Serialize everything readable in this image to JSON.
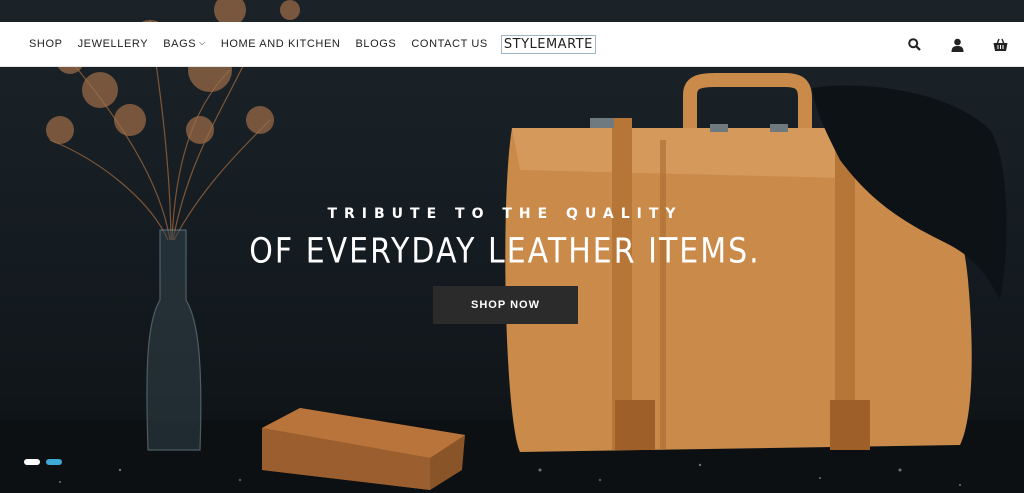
{
  "nav": {
    "items": [
      {
        "label": "SHOP",
        "has_dropdown": false
      },
      {
        "label": "JEWELLERY",
        "has_dropdown": false
      },
      {
        "label": "BAGS",
        "has_dropdown": true
      },
      {
        "label": "HOME AND KITCHEN",
        "has_dropdown": false
      },
      {
        "label": "BLOGS",
        "has_dropdown": false
      },
      {
        "label": "CONTACT US",
        "has_dropdown": false
      }
    ],
    "logo_text": "STYLEMARTE",
    "icons": [
      "search-icon",
      "user-icon",
      "cart-icon"
    ]
  },
  "hero": {
    "subtitle": "TRIBUTE TO THE QUALITY",
    "title": "OF EVERYDAY LEATHER ITEMS.",
    "cta_label": "SHOP NOW",
    "slides": 2,
    "active_slide": 2
  },
  "colors": {
    "nav_bg": "#ffffff",
    "nav_text": "#222222",
    "hero_bg": "#141b20",
    "button_bg": "#2b2b2b",
    "dot_inactive": "#ffffff",
    "dot_active": "#3fa9d6",
    "leather": "#c98a4a"
  }
}
